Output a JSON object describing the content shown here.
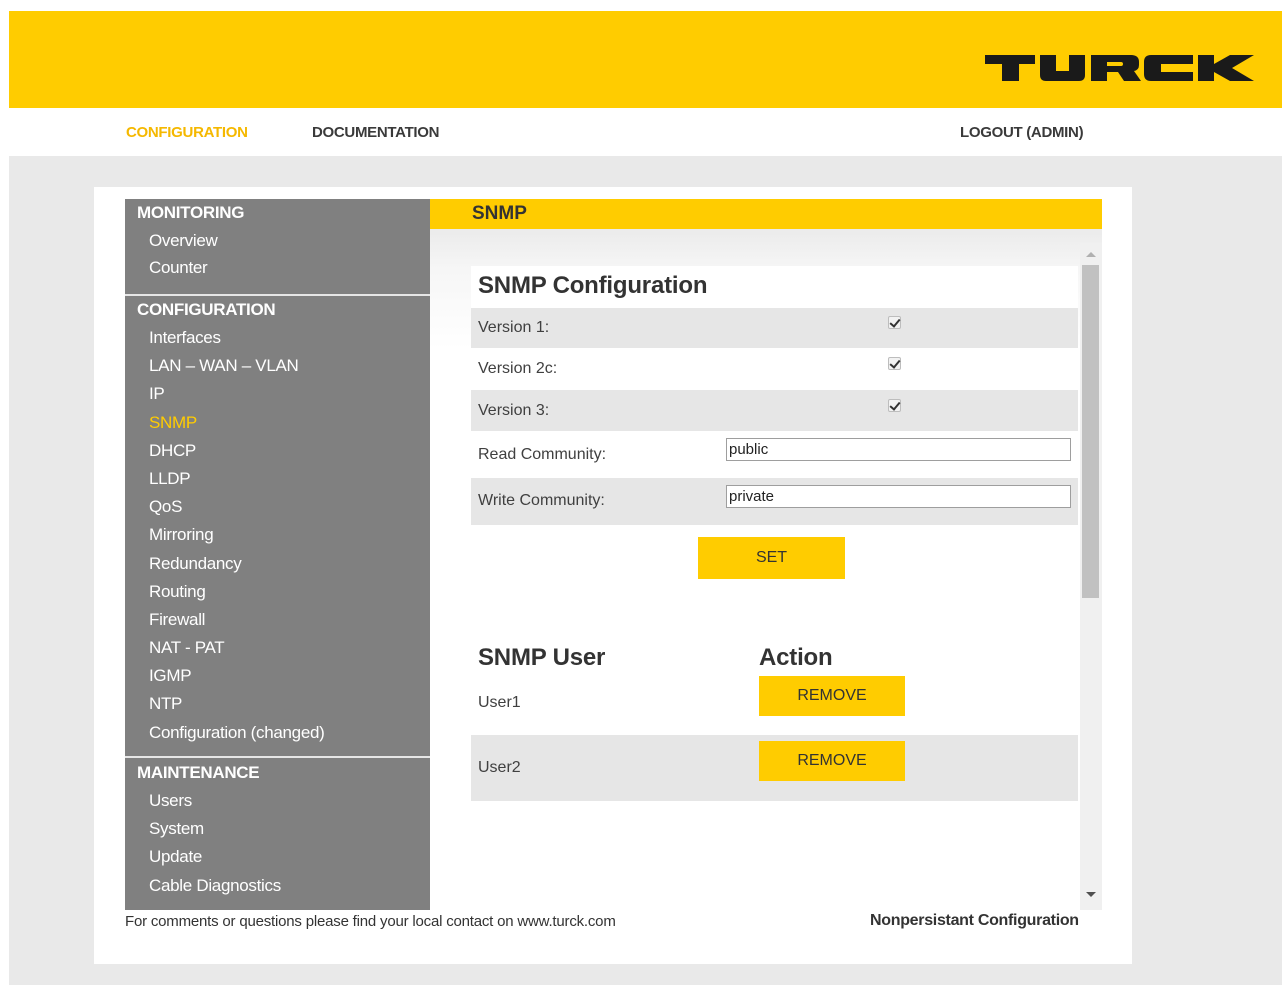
{
  "brand": {
    "logo_text": "TURCK",
    "accent_color": "#ffcc00",
    "sidebar_color": "#808080"
  },
  "topnav": {
    "configuration": "CONFIGURATION",
    "documentation": "DOCUMENTATION",
    "logout": "LOGOUT (ADMIN)"
  },
  "sidebar": {
    "monitoring": {
      "header": "MONITORING",
      "items": [
        "Overview",
        "Counter"
      ]
    },
    "configuration": {
      "header": "CONFIGURATION",
      "items": [
        "Interfaces",
        "LAN – WAN – VLAN",
        "IP",
        "SNMP",
        "DHCP",
        "LLDP",
        "QoS",
        "Mirroring",
        "Redundancy",
        "Routing",
        "Firewall",
        "NAT - PAT",
        "IGMP",
        "NTP",
        "Configuration (changed)"
      ],
      "active": "SNMP"
    },
    "maintenance": {
      "header": "MAINTENANCE",
      "items": [
        "Users",
        "System",
        "Update",
        "Cable Diagnostics"
      ]
    }
  },
  "page": {
    "title": "SNMP"
  },
  "snmp_config": {
    "title": "SNMP Configuration",
    "version1_label": "Version 1:",
    "version1_checked": true,
    "version2c_label": "Version 2c:",
    "version2c_checked": true,
    "version3_label": "Version 3:",
    "version3_checked": true,
    "read_community_label": "Read Community:",
    "read_community_value": "public",
    "write_community_label": "Write Community:",
    "write_community_value": "private",
    "set_button": "SET"
  },
  "snmp_users": {
    "user_header": "SNMP User",
    "action_header": "Action",
    "rows": [
      {
        "user": "User1",
        "action": "REMOVE"
      },
      {
        "user": "User2",
        "action": "REMOVE"
      }
    ]
  },
  "footer": {
    "contact": "For comments or questions please find your local contact on www.turck.com",
    "status": "Nonpersistant Configuration"
  }
}
